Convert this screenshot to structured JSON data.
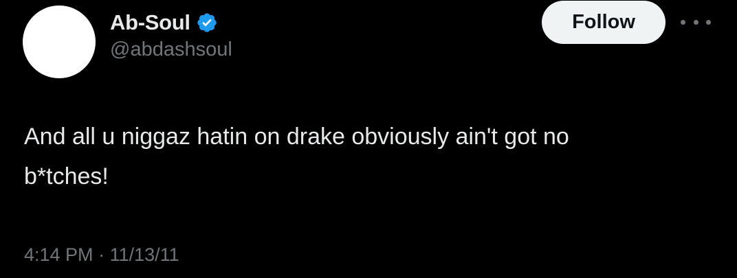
{
  "tweet": {
    "author": {
      "display_name": "Ab-Soul",
      "handle": "@abdashsoul",
      "verified": true,
      "verified_color": "#1d9bf0",
      "avatar_color": "#ffffff"
    },
    "follow_label": "Follow",
    "more_icon": "more-horizontal-icon",
    "text_line1": "And all u niggaz hatin on drake obviously ain't got no",
    "text_line2": "b*tches!",
    "time": "4:14 PM",
    "separator": "·",
    "date": "11/13/11"
  },
  "colors": {
    "background": "#000000",
    "primary_text": "#e7e9ea",
    "secondary_text": "#71767b",
    "button_bg": "#eff3f4",
    "button_text": "#0f1419"
  }
}
